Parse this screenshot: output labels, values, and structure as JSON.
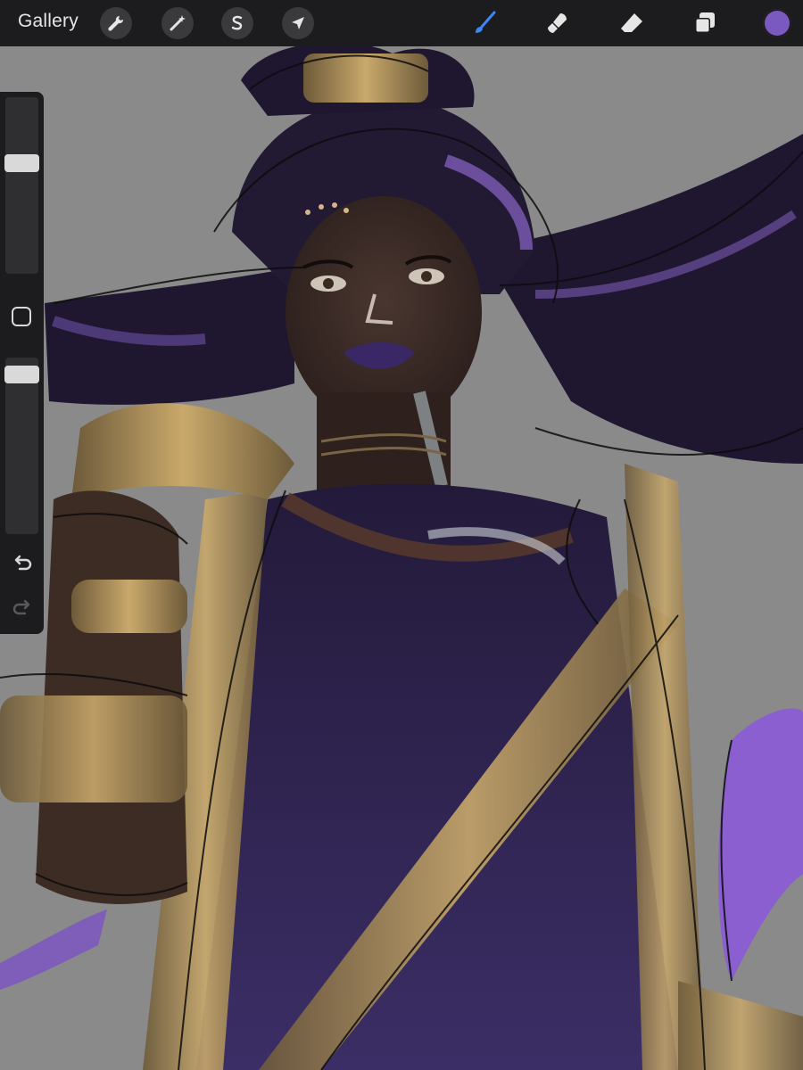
{
  "toolbar": {
    "gallery_label": "Gallery",
    "actions_icon": "wrench-icon",
    "adjustments_icon": "magic-wand-icon",
    "selection_icon": "selection-s-icon",
    "transform_icon": "arrow-cursor-icon",
    "brush_icon": "brush-icon",
    "smudge_icon": "smudge-icon",
    "eraser_icon": "eraser-icon",
    "layers_icon": "layers-icon",
    "active_tool": "brush",
    "current_color": "#7b5ac0"
  },
  "sidebar": {
    "brush_size_level": 0.64,
    "brush_opacity_level": 0.95,
    "modify_icon": "square-icon",
    "undo_icon": "undo-icon",
    "redo_icon": "redo-icon"
  },
  "colors": {
    "canvas_background": "#8a8a8a",
    "toolbar_background": "#1c1c1e",
    "accent_blue": "#3f86f5",
    "hair_purple": "#241a36",
    "dress_purple": "#2f2450",
    "gold": "#a88a55",
    "skin": "#3a2a24"
  }
}
